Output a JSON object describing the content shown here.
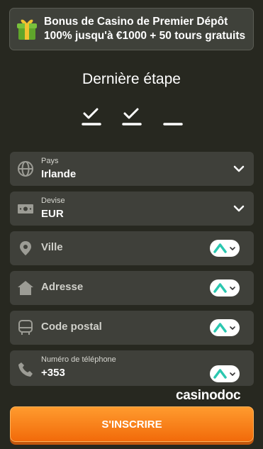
{
  "bonus": {
    "line1": "Bonus de Casino de Premier Dépôt",
    "line2": "100% jusqu'à €1000 + 50 tours gratuits"
  },
  "title": "Dernière étape",
  "steps": [
    "done",
    "done",
    "current"
  ],
  "fields": {
    "country": {
      "label": "Pays",
      "value": "Irlande"
    },
    "currency": {
      "label": "Devise",
      "value": "EUR"
    },
    "city": {
      "placeholder": "Ville"
    },
    "address": {
      "placeholder": "Adresse"
    },
    "postal": {
      "placeholder": "Code postal"
    },
    "phone": {
      "label": "Numéro de téléphone",
      "value": "+353"
    }
  },
  "logo": "casinodoc",
  "cta": "S'INSCRIRE",
  "colors": {
    "accent": "#f6791a",
    "panel": "#3f403a",
    "background": "#272820"
  }
}
